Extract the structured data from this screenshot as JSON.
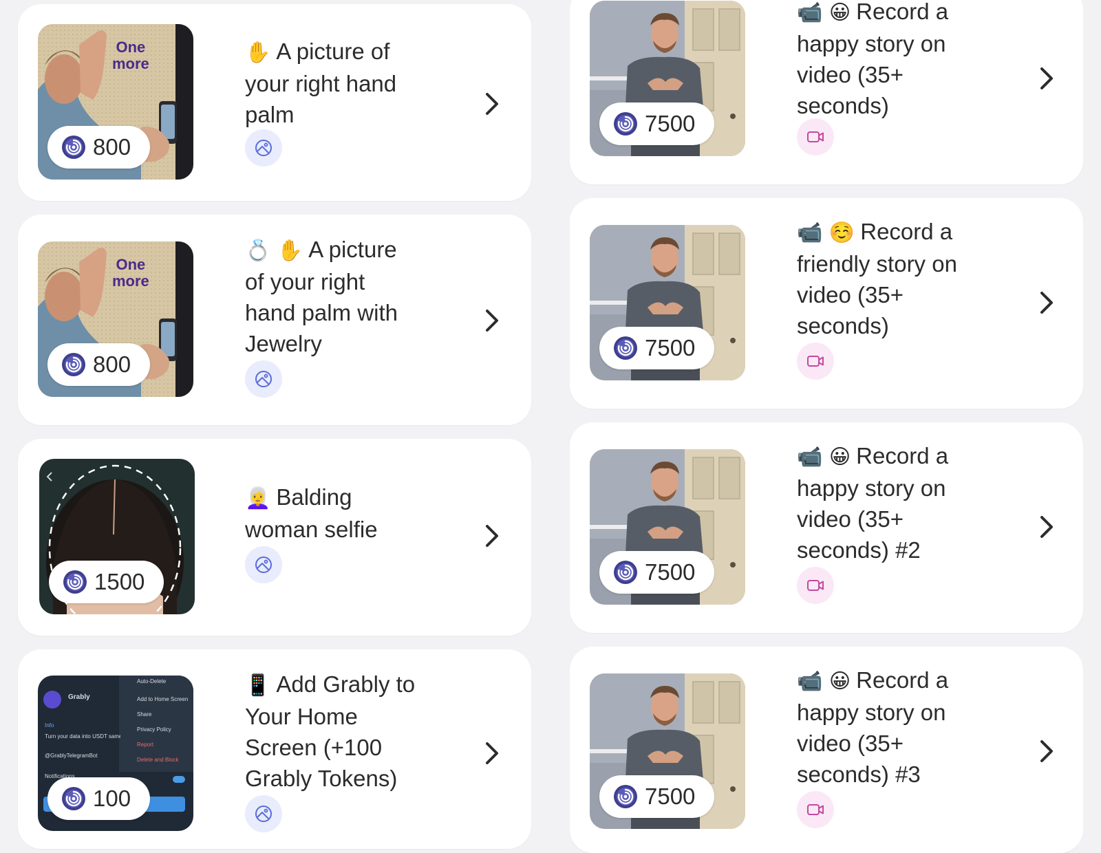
{
  "colors": {
    "background": "#f2f2f4",
    "card": "#ffffff",
    "image_badge_bg": "#e8ecfc",
    "image_badge_icon": "#5a6bd8",
    "video_badge_bg": "#fbe8f6",
    "video_badge_icon": "#c04a9e",
    "coin": "#3f3f8f"
  },
  "tasks_left": [
    {
      "emoji": "✋",
      "title": "A picture of your right hand palm",
      "reward": "800",
      "overlay_line1": "One",
      "overlay_line2": "more",
      "type_icon": "image-icon"
    },
    {
      "emoji": "💍 ✋",
      "title": "A picture of your right hand palm with Jewelry",
      "reward": "800",
      "overlay_line1": "One",
      "overlay_line2": "more",
      "type_icon": "image-icon"
    },
    {
      "emoji": "👩‍🦳",
      "title": "Balding woman selfie",
      "reward": "1500",
      "type_icon": "image-icon"
    },
    {
      "emoji": "📱",
      "title": "Add Grably to Your Home Screen (+100 Grably Tokens)",
      "reward": "100",
      "type_icon": "image-icon",
      "mock_screen": {
        "app_name": "Grably",
        "menu": [
          "Auto-Delete",
          "Add to Home Screen",
          "Share",
          "Privacy Policy",
          "Report",
          "Delete and Block"
        ],
        "info_label": "Info",
        "info_text": "Turn your data into USDT same",
        "handle": "@GrablyTelegramBot",
        "notif_label": "Notifications"
      }
    }
  ],
  "tasks_right": [
    {
      "emoji": "📹 😀",
      "title": "Record a happy story on video (35+ seconds)",
      "reward": "7500",
      "type_icon": "video-icon"
    },
    {
      "emoji": "📹 ☺️",
      "title": "Record a friendly story on video (35+ seconds)",
      "reward": "7500",
      "type_icon": "video-icon"
    },
    {
      "emoji": "📹 😀",
      "title": "Record a happy story on video (35+ seconds) #2",
      "reward": "7500",
      "type_icon": "video-icon"
    },
    {
      "emoji": "📹 😀",
      "title": "Record a happy story on video (35+ seconds) #3",
      "reward": "7500",
      "type_icon": "video-icon"
    }
  ]
}
